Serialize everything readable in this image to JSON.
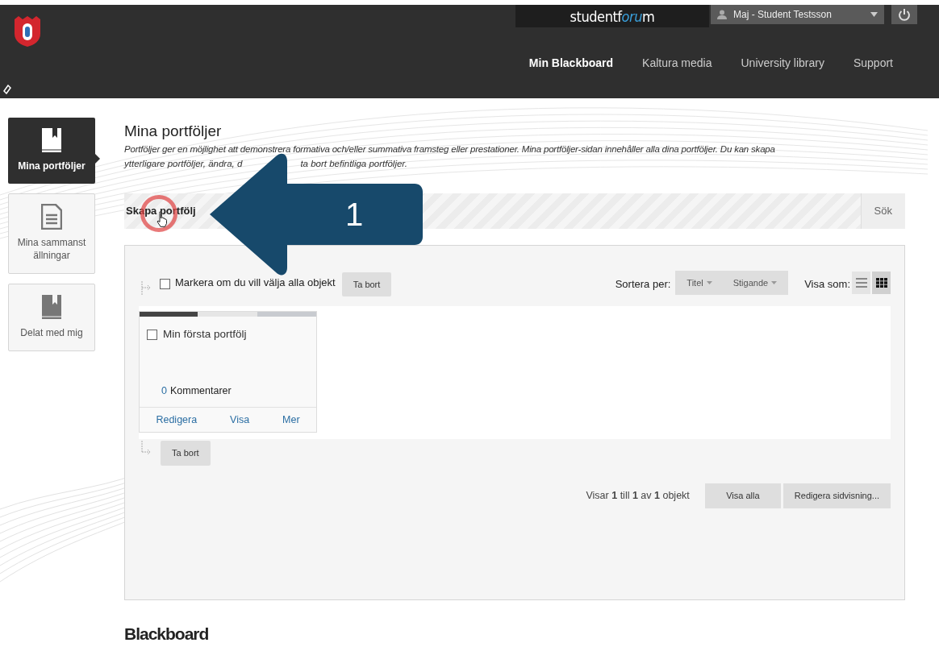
{
  "header": {
    "brand_start": "studentf",
    "brand_accent": "oru",
    "brand_end": "m",
    "user": "Maj - Student Testsson",
    "nav": [
      {
        "label": "Min Blackboard",
        "selected": true
      },
      {
        "label": "Kaltura media",
        "selected": false
      },
      {
        "label": "University library",
        "selected": false
      },
      {
        "label": "Support",
        "selected": false
      }
    ]
  },
  "sidebar": {
    "items": [
      {
        "label": "Mina portföljer",
        "kind": "book",
        "selected": true
      },
      {
        "label": "Mina sammanställningar",
        "kind": "document",
        "selected": false
      },
      {
        "label": "Delat med mig",
        "kind": "book",
        "selected": false
      }
    ]
  },
  "page": {
    "title": "Mina portföljer",
    "description_line_1": "Portföljer ger en möjlighet att demonstrera formativa och/eller summativa framsteg eller prestationer. Mina portföljer-sidan innehåller alla dina portföljer. Du kan skapa",
    "description_line_2_start": "ytterligare portföljer, ändra, d",
    "description_line_2_end": "ta bort befintliga portföljer."
  },
  "action_bar": {
    "create": "Skapa portfölj",
    "search": "Sök"
  },
  "toolbar": {
    "select_all": {
      "label": "Markera om du vill välja alla objekt",
      "checked": false
    },
    "delete": "Ta bort",
    "sort_label": "Sortera per:",
    "sort_options": [
      "Titel",
      "Stigande"
    ],
    "view_label": "Visa som:",
    "view_modes": [
      {
        "kind": "list",
        "selected": false
      },
      {
        "kind": "grid",
        "selected": true
      }
    ]
  },
  "portfolios": [
    {
      "title": "Min första portfölj",
      "checked": false,
      "comment_count": "0",
      "comment_label": "Kommentarer",
      "actions": [
        "Redigera",
        "Visa",
        "Mer"
      ]
    }
  ],
  "bottom_delete": "Ta bort",
  "paging": {
    "summary": "Visar **1** till **1** av **1** objekt",
    "buttons": [
      "Visa alla",
      "Redigera sidvisning..."
    ]
  },
  "footer": {
    "logo": "Blackboard"
  },
  "callout": {
    "number": "1"
  }
}
